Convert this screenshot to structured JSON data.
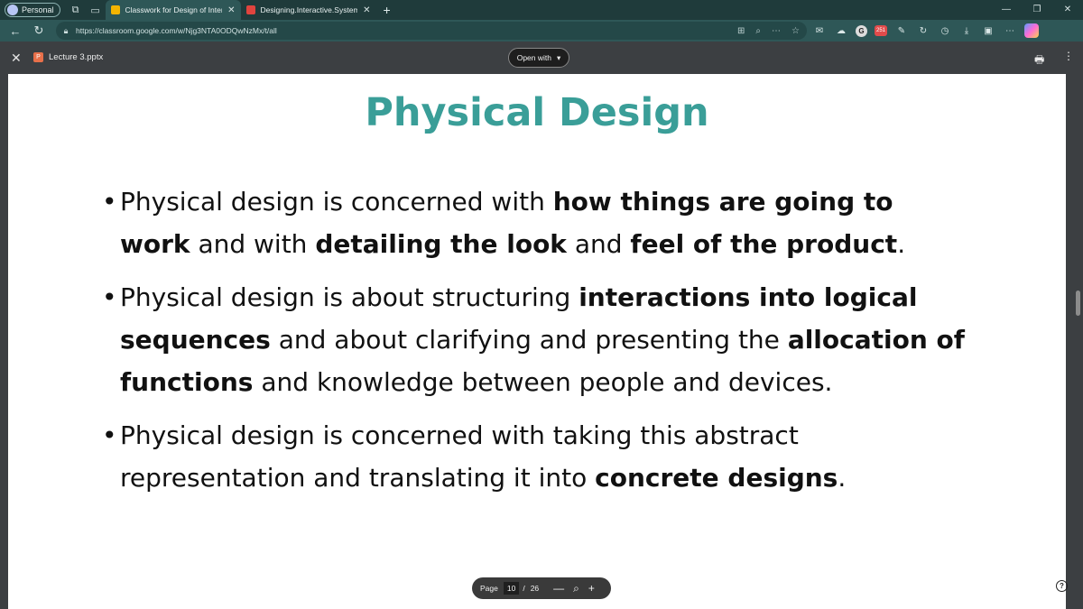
{
  "browser": {
    "profile_label": "Personal",
    "tabs": [
      {
        "title": "Classwork for Design of Interactive",
        "favicon": "classroom-icon",
        "color": "#f4b400",
        "active": true
      },
      {
        "title": "Designing.Interactive.Systems.A.C",
        "favicon": "pdf-icon",
        "color": "#e0443e",
        "active": false
      }
    ],
    "url": "https://classroom.google.com/w/Njg3NTA0ODQwNzMx/t/all",
    "extension_badge": "251"
  },
  "viewer": {
    "file_name": "Lecture 3.pptx",
    "file_icon_letter": "P",
    "open_with_label": "Open with"
  },
  "slide": {
    "title": "Physical Design",
    "title_color": "#3a9e98",
    "bullets": [
      [
        {
          "t": "Physical design is concerned with "
        },
        {
          "t": "how things are going to work",
          "b": true
        },
        {
          "t": " and with "
        },
        {
          "t": "detailing the look",
          "b": true
        },
        {
          "t": " and "
        },
        {
          "t": "feel of the product",
          "b": true
        },
        {
          "t": "."
        }
      ],
      [
        {
          "t": "Physical design is about structuring "
        },
        {
          "t": "interactions into logical sequences",
          "b": true
        },
        {
          "t": " and about clarifying and presenting the "
        },
        {
          "t": "allocation of functions",
          "b": true
        },
        {
          "t": " and knowledge between people and devices."
        }
      ],
      [
        {
          "t": "Physical design is concerned with taking this abstract representation and translating it into "
        },
        {
          "t": "concrete designs",
          "b": true
        },
        {
          "t": "."
        }
      ]
    ]
  },
  "pager": {
    "label": "Page",
    "current": "10",
    "separator": "/",
    "total": "26"
  }
}
